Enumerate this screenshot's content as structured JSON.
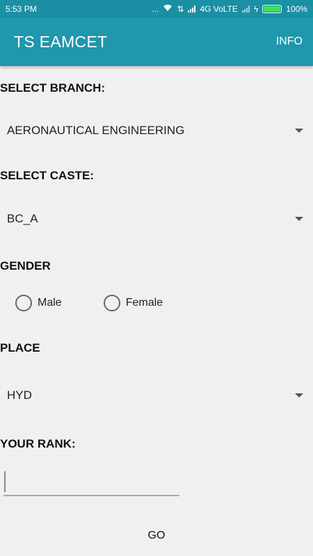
{
  "status_bar": {
    "time": "5:53 PM",
    "dots": "...",
    "network_label": "4G VoLTE",
    "battery_percent": "100%",
    "battery_level": 1.0,
    "battery_color": "#3ee34e"
  },
  "app_bar": {
    "title": "TS EAMCET",
    "info_label": "INFO",
    "color": "#1f97ad"
  },
  "form": {
    "branch_label": "SELECT BRANCH:",
    "branch_value": "AERONAUTICAL ENGINEERING",
    "caste_label": "SELECT CASTE:",
    "caste_value": "BC_A",
    "gender_label": "GENDER",
    "gender_options": [
      "Male",
      "Female"
    ],
    "place_label": "PLACE",
    "place_value": "HYD",
    "rank_label": "YOUR RANK:",
    "rank_value": "",
    "go_label": "GO"
  }
}
